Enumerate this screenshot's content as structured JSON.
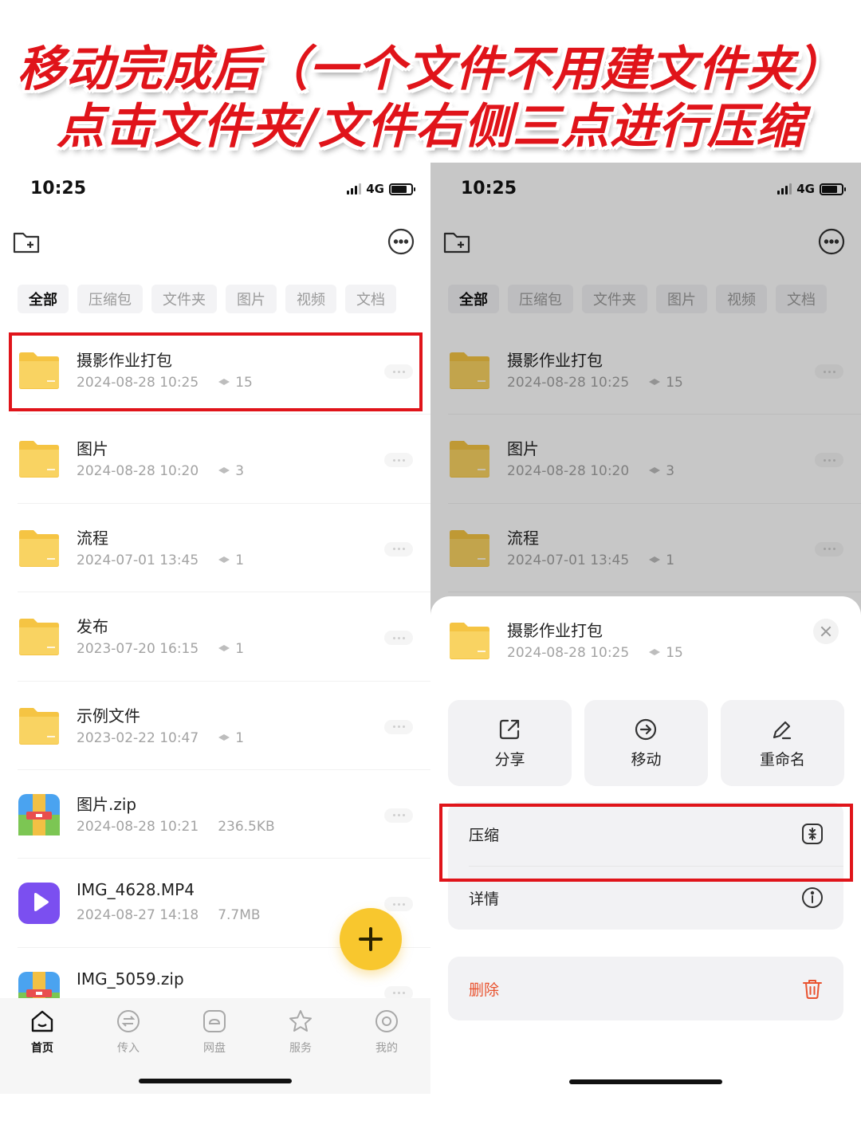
{
  "banner": {
    "line1": "移动完成后（一个文件不用建文件夹）",
    "line2": "点击文件夹/文件右侧三点进行压缩"
  },
  "status": {
    "time": "10:25",
    "network": "4G",
    "battery_level": 0.8
  },
  "filters": [
    "全部",
    "压缩包",
    "文件夹",
    "图片",
    "视频",
    "文档"
  ],
  "files": [
    {
      "name": "摄影作业打包",
      "date": "2024-08-28 10:25",
      "count": "15",
      "type": "folder"
    },
    {
      "name": "图片",
      "date": "2024-08-28 10:20",
      "count": "3",
      "type": "folder"
    },
    {
      "name": "流程",
      "date": "2024-07-01 13:45",
      "count": "1",
      "type": "folder"
    },
    {
      "name": "发布",
      "date": "2023-07-20 16:15",
      "count": "1",
      "type": "folder"
    },
    {
      "name": "示例文件",
      "date": "2023-02-22 10:47",
      "count": "1",
      "type": "folder"
    },
    {
      "name": "图片.zip",
      "date": "2024-08-28 10:21",
      "size": "236.5KB",
      "type": "zip"
    },
    {
      "name": "IMG_4628.MP4",
      "date": "2024-08-27 14:18",
      "size": "7.7MB",
      "type": "video"
    },
    {
      "name": "IMG_5059.zip",
      "date": "",
      "size": "",
      "type": "zip"
    }
  ],
  "tabs": [
    {
      "label": "首页",
      "icon": "home-icon"
    },
    {
      "label": "传入",
      "icon": "transfer-icon"
    },
    {
      "label": "网盘",
      "icon": "cloud-drive-icon"
    },
    {
      "label": "服务",
      "icon": "star-icon"
    },
    {
      "label": "我的",
      "icon": "profile-icon"
    }
  ],
  "sheet": {
    "file": {
      "name": "摄影作业打包",
      "date": "2024-08-28 10:25",
      "count": "15"
    },
    "actions": [
      "分享",
      "移动",
      "重命名"
    ],
    "menu": [
      "压缩",
      "详情"
    ],
    "delete_label": "删除"
  },
  "colors": {
    "accent_red": "#e0141a",
    "fab_yellow": "#f8c72e",
    "delete_orange": "#e9532f",
    "folder_yellow": "#f7cc52"
  }
}
